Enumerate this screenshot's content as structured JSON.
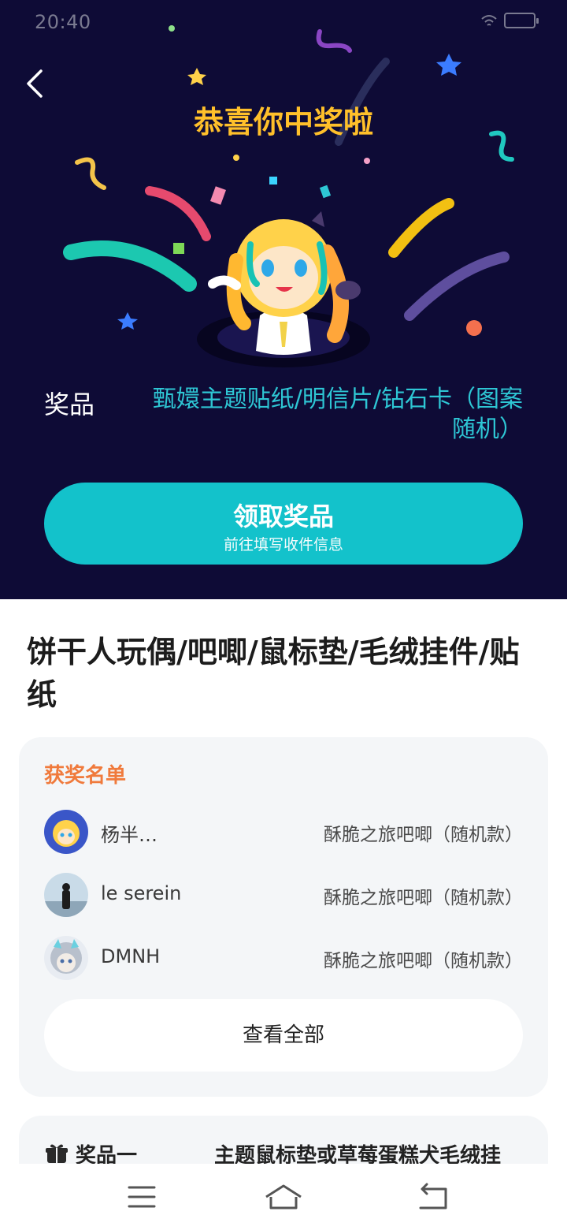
{
  "status_bar": {
    "time": "20:40"
  },
  "hero": {
    "title": "恭喜你中奖啦",
    "prize_label": "奖品",
    "prize_value": "甄嬛主题贴纸/明信片/钻石卡（图案随机）",
    "claim_button": {
      "label": "领取奖品",
      "sublabel": "前往填写收件信息"
    }
  },
  "product": {
    "title": "饼干人玩偶/吧唧/鼠标垫/毛绒挂件/贴纸"
  },
  "winners": {
    "heading": "获奖名单",
    "rows": [
      {
        "name": "杨半…",
        "prize": "酥脆之旅吧唧（随机款）"
      },
      {
        "name": "le serein",
        "prize": "酥脆之旅吧唧（随机款）"
      },
      {
        "name": "DMNH",
        "prize": "酥脆之旅吧唧（随机款）"
      }
    ],
    "view_all": "查看全部"
  },
  "prize_list": {
    "first": {
      "label": "奖品一",
      "value": "主题鼠标垫或草莓蛋糕犬毛绒挂"
    }
  },
  "colors": {
    "hero_bg": "#0e0b36",
    "accent_teal": "#13c2cb",
    "title_yellow": "#ffc02a",
    "heading_orange": "#f07a3c"
  },
  "icons": [
    "back-icon",
    "wifi-icon",
    "battery-icon",
    "gift-icon",
    "menu-icon",
    "home-icon",
    "return-icon"
  ]
}
